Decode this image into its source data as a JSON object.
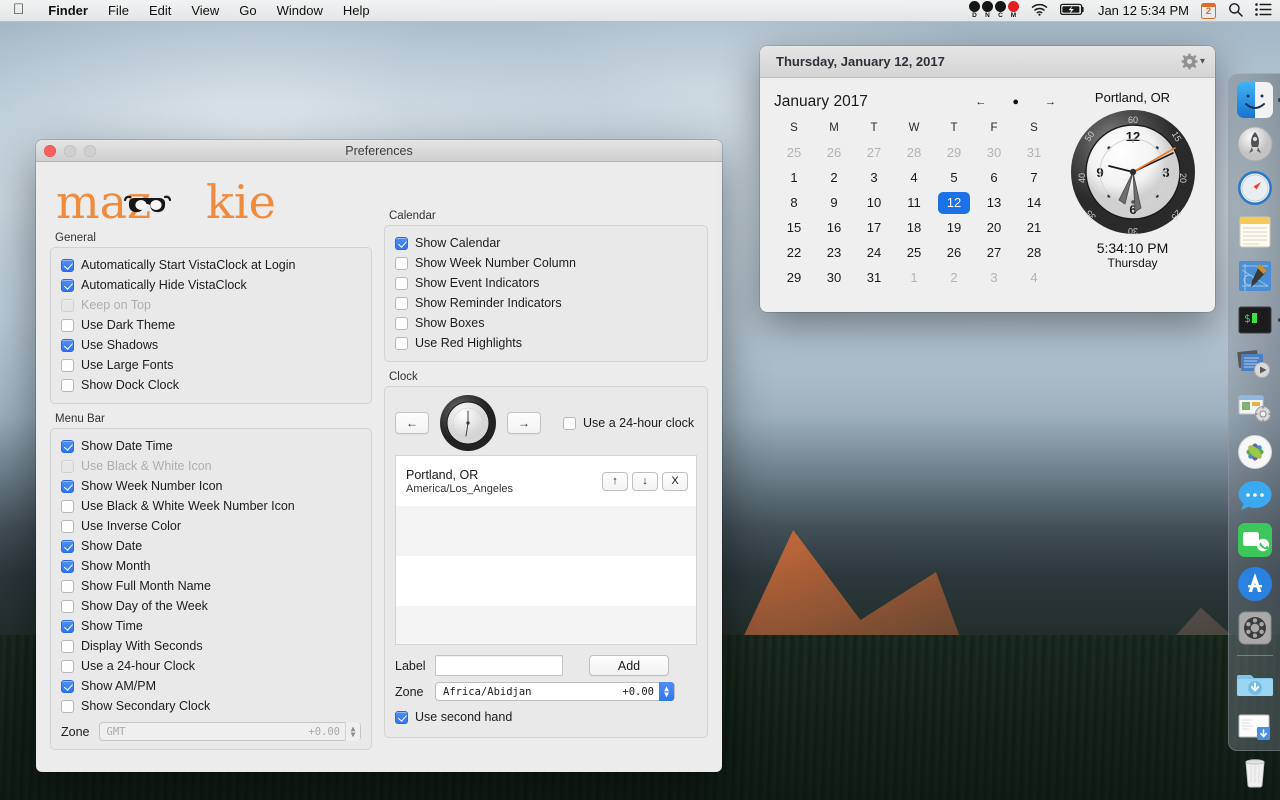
{
  "menubar": {
    "apple_icon": "apple-logo",
    "items": [
      {
        "label": "Finder",
        "bold": true
      },
      {
        "label": "File",
        "bold": false
      },
      {
        "label": "Edit",
        "bold": false
      },
      {
        "label": "View",
        "bold": false
      },
      {
        "label": "Go",
        "bold": false
      },
      {
        "label": "Window",
        "bold": false
      },
      {
        "label": "Help",
        "bold": false
      }
    ],
    "status_dots": [
      {
        "letter": "D",
        "color": "#151515"
      },
      {
        "letter": "N",
        "color": "#151515"
      },
      {
        "letter": "C",
        "color": "#151515"
      },
      {
        "letter": "M",
        "color": "#e02020"
      }
    ],
    "wifi_icon": "wifi-icon",
    "battery_icon": "battery-charging-icon",
    "datetime": "Jan 12  5:34 PM",
    "week_badge": "2",
    "search_icon": "search-icon",
    "notification_icon": "notification-center-icon"
  },
  "prefs_window": {
    "title": "Preferences",
    "logo_text": "mazookie",
    "logo_color": "#f08a3c",
    "general": {
      "label": "General",
      "items": [
        {
          "label": "Automatically Start VistaClock at Login",
          "checked": true,
          "disabled": false
        },
        {
          "label": "Automatically Hide VistaClock",
          "checked": true,
          "disabled": false
        },
        {
          "label": "Keep on Top",
          "checked": false,
          "disabled": true
        },
        {
          "label": "Use Dark Theme",
          "checked": false,
          "disabled": false
        },
        {
          "label": "Use Shadows",
          "checked": true,
          "disabled": false
        },
        {
          "label": "Use Large Fonts",
          "checked": false,
          "disabled": false
        },
        {
          "label": "Show Dock Clock",
          "checked": false,
          "disabled": false
        }
      ]
    },
    "menu_bar_group": {
      "label": "Menu Bar",
      "items": [
        {
          "label": "Show Date Time",
          "checked": true,
          "disabled": false
        },
        {
          "label": "Use Black & White Icon",
          "checked": false,
          "disabled": true
        },
        {
          "label": "Show Week Number Icon",
          "checked": true,
          "disabled": false
        },
        {
          "label": "Use Black & White Week Number Icon",
          "checked": false,
          "disabled": false
        },
        {
          "label": "Use Inverse Color",
          "checked": false,
          "disabled": false
        },
        {
          "label": "Show Date",
          "checked": true,
          "disabled": false
        },
        {
          "label": "Show Month",
          "checked": true,
          "disabled": false
        },
        {
          "label": "Show Full Month Name",
          "checked": false,
          "disabled": false
        },
        {
          "label": "Show Day of the Week",
          "checked": false,
          "disabled": false
        },
        {
          "label": "Show Time",
          "checked": true,
          "disabled": false
        },
        {
          "label": "Display With Seconds",
          "checked": false,
          "disabled": false
        },
        {
          "label": "Use a 24-hour Clock",
          "checked": false,
          "disabled": false
        },
        {
          "label": "Show AM/PM",
          "checked": true,
          "disabled": false
        },
        {
          "label": "Show Secondary Clock",
          "checked": false,
          "disabled": false
        }
      ],
      "zone_label": "Zone",
      "zone_value": "GMT",
      "zone_offset": "+0.00",
      "zone_disabled": true
    },
    "calendar_group": {
      "label": "Calendar",
      "items": [
        {
          "label": "Show Calendar",
          "checked": true,
          "disabled": false
        },
        {
          "label": "Show Week Number Column",
          "checked": false,
          "disabled": false
        },
        {
          "label": "Show Event Indicators",
          "checked": false,
          "disabled": false
        },
        {
          "label": "Show Reminder Indicators",
          "checked": false,
          "disabled": false
        },
        {
          "label": "Show Boxes",
          "checked": false,
          "disabled": false
        },
        {
          "label": "Use Red Highlights",
          "checked": false,
          "disabled": false
        }
      ]
    },
    "clock_group": {
      "label": "Clock",
      "prev_button": "←",
      "next_button": "→",
      "use_24h_label": "Use a 24-hour clock",
      "use_24h_checked": false,
      "timezone_rows": [
        {
          "city": "Portland, OR",
          "zone_id": "America/Los_Angeles",
          "up": "↑",
          "down": "↓",
          "remove": "X"
        }
      ],
      "label_field_label": "Label",
      "label_field_value": "",
      "add_button": "Add",
      "zone_label": "Zone",
      "zone_value": "Africa/Abidjan",
      "zone_offset": "+0.00",
      "second_hand_label": "Use second hand",
      "second_hand_checked": true
    }
  },
  "widget": {
    "title": "Thursday, January 12, 2017",
    "gear_icon": "gear-icon",
    "month_label": "January 2017",
    "nav_prev": "←",
    "nav_today": "●",
    "nav_next": "→",
    "day_headers": [
      "S",
      "M",
      "T",
      "W",
      "T",
      "F",
      "S"
    ],
    "weeks": [
      [
        {
          "d": "25",
          "o": true
        },
        {
          "d": "26",
          "o": true
        },
        {
          "d": "27",
          "o": true
        },
        {
          "d": "28",
          "o": true
        },
        {
          "d": "29",
          "o": true
        },
        {
          "d": "30",
          "o": true
        },
        {
          "d": "31",
          "o": true
        }
      ],
      [
        {
          "d": "1"
        },
        {
          "d": "2"
        },
        {
          "d": "3"
        },
        {
          "d": "4"
        },
        {
          "d": "5"
        },
        {
          "d": "6"
        },
        {
          "d": "7"
        }
      ],
      [
        {
          "d": "8"
        },
        {
          "d": "9"
        },
        {
          "d": "10"
        },
        {
          "d": "11"
        },
        {
          "d": "12",
          "today": true
        },
        {
          "d": "13"
        },
        {
          "d": "14"
        }
      ],
      [
        {
          "d": "15"
        },
        {
          "d": "16"
        },
        {
          "d": "17"
        },
        {
          "d": "18"
        },
        {
          "d": "19"
        },
        {
          "d": "20"
        },
        {
          "d": "21"
        }
      ],
      [
        {
          "d": "22"
        },
        {
          "d": "23"
        },
        {
          "d": "24"
        },
        {
          "d": "25"
        },
        {
          "d": "26"
        },
        {
          "d": "27"
        },
        {
          "d": "28"
        }
      ],
      [
        {
          "d": "29"
        },
        {
          "d": "30"
        },
        {
          "d": "31"
        },
        {
          "d": "1",
          "o": true
        },
        {
          "d": "2",
          "o": true
        },
        {
          "d": "3",
          "o": true
        },
        {
          "d": "4",
          "o": true
        }
      ]
    ],
    "city": "Portland, OR",
    "digital_time": "5:34:10 PM",
    "day_name": "Thursday",
    "today_highlight_color": "#1a71e8",
    "second_hand_color": "#f07a22"
  },
  "dock": {
    "icons": [
      {
        "name": "finder",
        "running": true
      },
      {
        "name": "launchpad",
        "running": false
      },
      {
        "name": "safari",
        "running": false
      },
      {
        "name": "notes",
        "running": false
      },
      {
        "name": "xcode",
        "running": false
      },
      {
        "name": "terminal",
        "running": true
      },
      {
        "name": "quicktime",
        "running": false
      },
      {
        "name": "automator",
        "running": false
      },
      {
        "name": "photos",
        "running": false
      },
      {
        "name": "messages",
        "running": false
      },
      {
        "name": "facetime",
        "running": false
      },
      {
        "name": "app-store",
        "running": false
      },
      {
        "name": "system-preferences",
        "running": false
      },
      {
        "name": "downloads-folder",
        "running": false
      },
      {
        "name": "document-stack",
        "running": false
      },
      {
        "name": "trash",
        "running": false
      }
    ]
  }
}
